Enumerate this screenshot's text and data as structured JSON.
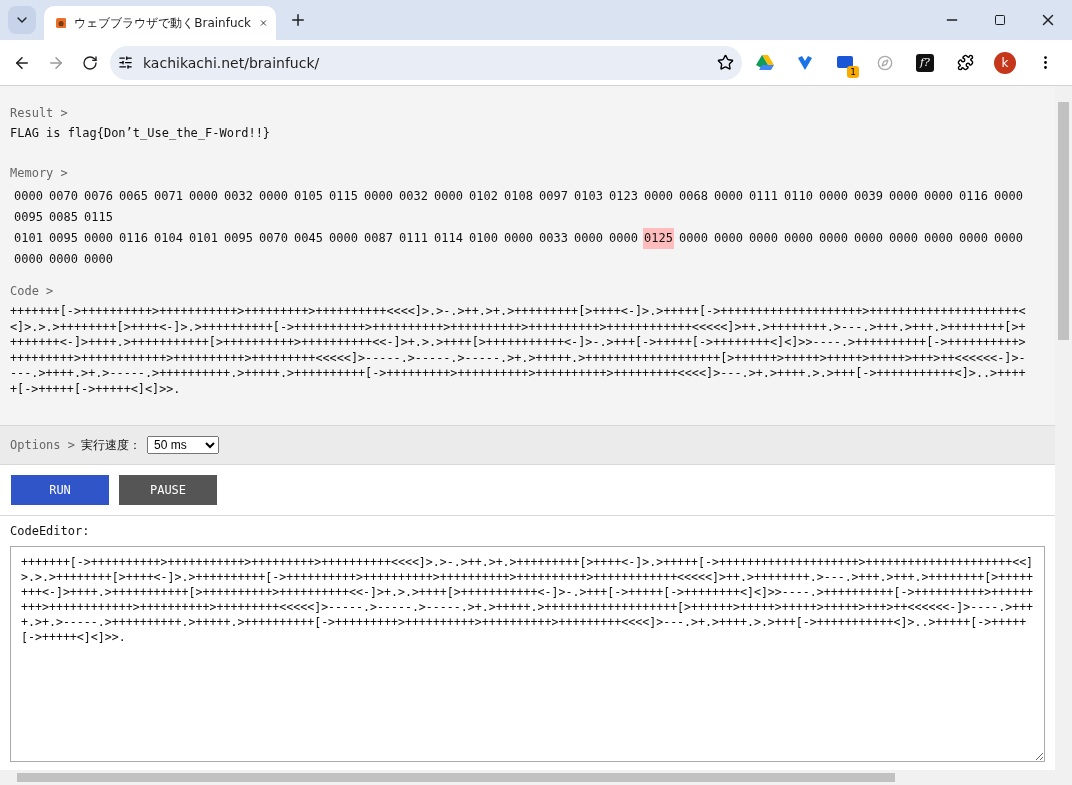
{
  "browser": {
    "tab_title": "ウェブブラウザで動くBrainfuck",
    "address": "kachikachi.net/brainfuck/",
    "extension_label": "f?",
    "extension_badge": "1",
    "profile_initial": "k"
  },
  "result": {
    "label": "Result >",
    "text": "FLAG is flag{Don’t_Use_the_F-Word!!}"
  },
  "memory": {
    "label": "Memory >",
    "rows": [
      {
        "cells": [
          {
            "value": "0000",
            "selected": false
          },
          {
            "value": "0070",
            "selected": false
          },
          {
            "value": "0076",
            "selected": false
          },
          {
            "value": "0065",
            "selected": false
          },
          {
            "value": "0071",
            "selected": false
          },
          {
            "value": "0000",
            "selected": false
          },
          {
            "value": "0032",
            "selected": false
          },
          {
            "value": "0000",
            "selected": false
          },
          {
            "value": "0105",
            "selected": false
          },
          {
            "value": "0115",
            "selected": false
          },
          {
            "value": "0000",
            "selected": false
          },
          {
            "value": "0032",
            "selected": false
          },
          {
            "value": "0000",
            "selected": false
          },
          {
            "value": "0102",
            "selected": false
          },
          {
            "value": "0108",
            "selected": false
          },
          {
            "value": "0097",
            "selected": false
          },
          {
            "value": "0103",
            "selected": false
          },
          {
            "value": "0123",
            "selected": false
          },
          {
            "value": "0000",
            "selected": false
          },
          {
            "value": "0068",
            "selected": false
          },
          {
            "value": "0000",
            "selected": false
          },
          {
            "value": "0111",
            "selected": false
          },
          {
            "value": "0110",
            "selected": false
          },
          {
            "value": "0000",
            "selected": false
          },
          {
            "value": "0039",
            "selected": false
          },
          {
            "value": "0000",
            "selected": false
          },
          {
            "value": "0000",
            "selected": false
          },
          {
            "value": "0116",
            "selected": false
          },
          {
            "value": "0000",
            "selected": false
          },
          {
            "value": "0095",
            "selected": false
          },
          {
            "value": "0085",
            "selected": false
          },
          {
            "value": "0115",
            "selected": false
          }
        ]
      },
      {
        "cells": [
          {
            "value": "0101",
            "selected": false
          },
          {
            "value": "0095",
            "selected": false
          },
          {
            "value": "0000",
            "selected": false
          },
          {
            "value": "0116",
            "selected": false
          },
          {
            "value": "0104",
            "selected": false
          },
          {
            "value": "0101",
            "selected": false
          },
          {
            "value": "0095",
            "selected": false
          },
          {
            "value": "0070",
            "selected": false
          },
          {
            "value": "0045",
            "selected": false
          },
          {
            "value": "0000",
            "selected": false
          },
          {
            "value": "0087",
            "selected": false
          },
          {
            "value": "0111",
            "selected": false
          },
          {
            "value": "0114",
            "selected": false
          },
          {
            "value": "0100",
            "selected": false
          },
          {
            "value": "0000",
            "selected": false
          },
          {
            "value": "0033",
            "selected": false
          },
          {
            "value": "0000",
            "selected": false
          },
          {
            "value": "0000",
            "selected": false
          },
          {
            "value": "0125",
            "selected": true
          },
          {
            "value": "0000",
            "selected": false
          },
          {
            "value": "0000",
            "selected": false
          },
          {
            "value": "0000",
            "selected": false
          },
          {
            "value": "0000",
            "selected": false
          },
          {
            "value": "0000",
            "selected": false
          },
          {
            "value": "0000",
            "selected": false
          },
          {
            "value": "0000",
            "selected": false
          },
          {
            "value": "0000",
            "selected": false
          },
          {
            "value": "0000",
            "selected": false
          },
          {
            "value": "0000",
            "selected": false
          },
          {
            "value": "0000",
            "selected": false
          },
          {
            "value": "0000",
            "selected": false
          },
          {
            "value": "0000",
            "selected": false
          }
        ]
      }
    ]
  },
  "code": {
    "label": "Code >",
    "text": "+++++++[->++++++++++>+++++++++++>+++++++++>++++++++++<<<<]>.>-.>++.>+.>+++++++++[>++++<-]>.>+++++[->++++++++++++++++++++>+++++++++++++++++++++<<]>.>.>++++++++[>++++<-]>.>++++++++++[->++++++++++>++++++++++>++++++++++>++++++++++>++++++++++++<<<<<]>++.>++++++++.>---.>+++.>+++.>++++++++[>++++++++<-]>++++.>+++++++++++[>++++++++++>++++++++++<<-]>+.>.>++++[>+++++++++++<-]>-.>+++[->+++++[->++++++++<]<]>>----.>++++++++++[->++++++++++>+++++++++>++++++++++++>++++++++++>+++++++++<<<<<]>-----.>-----.>-----.>+.>+++++.>+++++++++++++++++++[>++++++>+++++>+++++>+++++>+++>++<<<<<<-]>----.>++++.>+.>-----.>++++++++++.>+++++.>++++++++++[->+++++++++>++++++++++>++++++++++>+++++++++<<<<]>---.>+.>++++.>.>+++[->+++++++++++<]>..>+++++[->+++++[->+++++<]<]>>."
  },
  "options": {
    "label": "Options >",
    "speed_label": "実行速度：",
    "speed_value": "50 ms"
  },
  "buttons": [
    {
      "label": "RUN",
      "kind": "primary"
    },
    {
      "label": "PAUSE",
      "kind": "secondary"
    }
  ],
  "code_editor": {
    "label": "CodeEditor:",
    "value": "+++++++[->++++++++++>+++++++++++>+++++++++>++++++++++<<<<]>.>-.>++.>+.>+++++++++[>++++<-]>.>+++++[->++++++++++++++++++++>+++++++++++++++++++++<<]>.>.>++++++++[>++++<-]>.>++++++++++[->++++++++++>++++++++++>++++++++++>++++++++++>++++++++++++<<<<<]>++.>++++++++.>---.>+++.>+++.>++++++++[>++++++++<-]>++++.>+++++++++++[>++++++++++>++++++++++<<-]>+.>.>++++[>+++++++++++<-]>-.>+++[->+++++[->++++++++<]<]>>----.>++++++++++[->++++++++++>+++++++++>++++++++++++>++++++++++>+++++++++<<<<<]>-----.>-----.>-----.>+.>+++++.>+++++++++++++++++++[>++++++>+++++>+++++>+++++>+++>++<<<<<<-]>----.>++++.>+.>-----.>++++++++++.>+++++.>++++++++++[->+++++++++>++++++++++>++++++++++>+++++++++<<<<]>---.>+.>++++.>.>+++[->+++++++++++<]>..>+++++[->+++++[->+++++<]<]>>."
  }
}
